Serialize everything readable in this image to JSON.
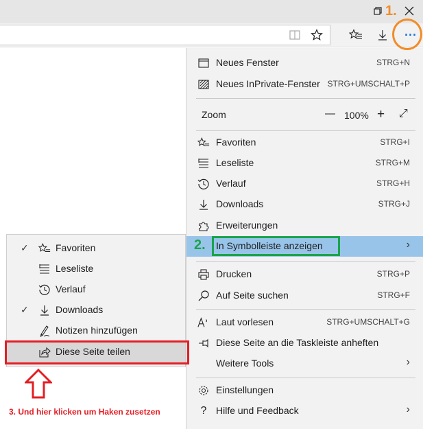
{
  "window": {
    "restore_icon": "restore-icon",
    "close_icon": "close-icon"
  },
  "toolbar": {
    "reading_view_icon": "reading-view-icon",
    "favorite_star_icon": "star-icon",
    "favorites_hub_icon": "favorites-icon",
    "downloads_icon": "download-icon",
    "more_icon": "more-icon",
    "more_label": "···"
  },
  "main_menu": {
    "new_window": {
      "label": "Neues Fenster",
      "shortcut": "STRG+N"
    },
    "new_inprivate": {
      "label": "Neues InPrivate-Fenster",
      "shortcut": "STRG+UMSCHALT+P"
    },
    "zoom": {
      "label": "Zoom",
      "minus": "—",
      "value": "100%",
      "plus": "+",
      "fullscreen": "⤢"
    },
    "favorites": {
      "label": "Favoriten",
      "shortcut": "STRG+I"
    },
    "reading_list": {
      "label": "Leseliste",
      "shortcut": "STRG+M"
    },
    "history": {
      "label": "Verlauf",
      "shortcut": "STRG+H"
    },
    "downloads": {
      "label": "Downloads",
      "shortcut": "STRG+J"
    },
    "extensions": {
      "label": "Erweiterungen"
    },
    "show_in_toolbar": {
      "label": "In Symbolleiste anzeigen"
    },
    "print": {
      "label": "Drucken",
      "shortcut": "STRG+P"
    },
    "find": {
      "label": "Auf Seite suchen",
      "shortcut": "STRG+F"
    },
    "read_aloud": {
      "label": "Laut vorlesen",
      "shortcut": "STRG+UMSCHALT+G"
    },
    "pin_taskbar": {
      "label": "Diese Seite an die Taskleiste anheften"
    },
    "more_tools": {
      "label": "Weitere Tools"
    },
    "settings": {
      "label": "Einstellungen"
    },
    "help": {
      "label": "Hilfe und Feedback"
    }
  },
  "submenu": {
    "items": [
      {
        "label": "Favoriten",
        "checked": true
      },
      {
        "label": "Leseliste",
        "checked": false
      },
      {
        "label": "Verlauf",
        "checked": false
      },
      {
        "label": "Downloads",
        "checked": true
      },
      {
        "label": "Notizen hinzufügen",
        "checked": false
      },
      {
        "label": "Diese Seite teilen",
        "checked": false
      }
    ],
    "check_mark": "✓"
  },
  "annotations": {
    "step1": "1.",
    "step2": "2.",
    "step3": "3. Und hier klicken um Haken zusetzen",
    "orange": "#f28c28",
    "green": "#1aa34a",
    "red": "#e31e24"
  },
  "colors": {
    "menu_bg": "#f2f2f2",
    "highlight": "#99c4ea"
  }
}
